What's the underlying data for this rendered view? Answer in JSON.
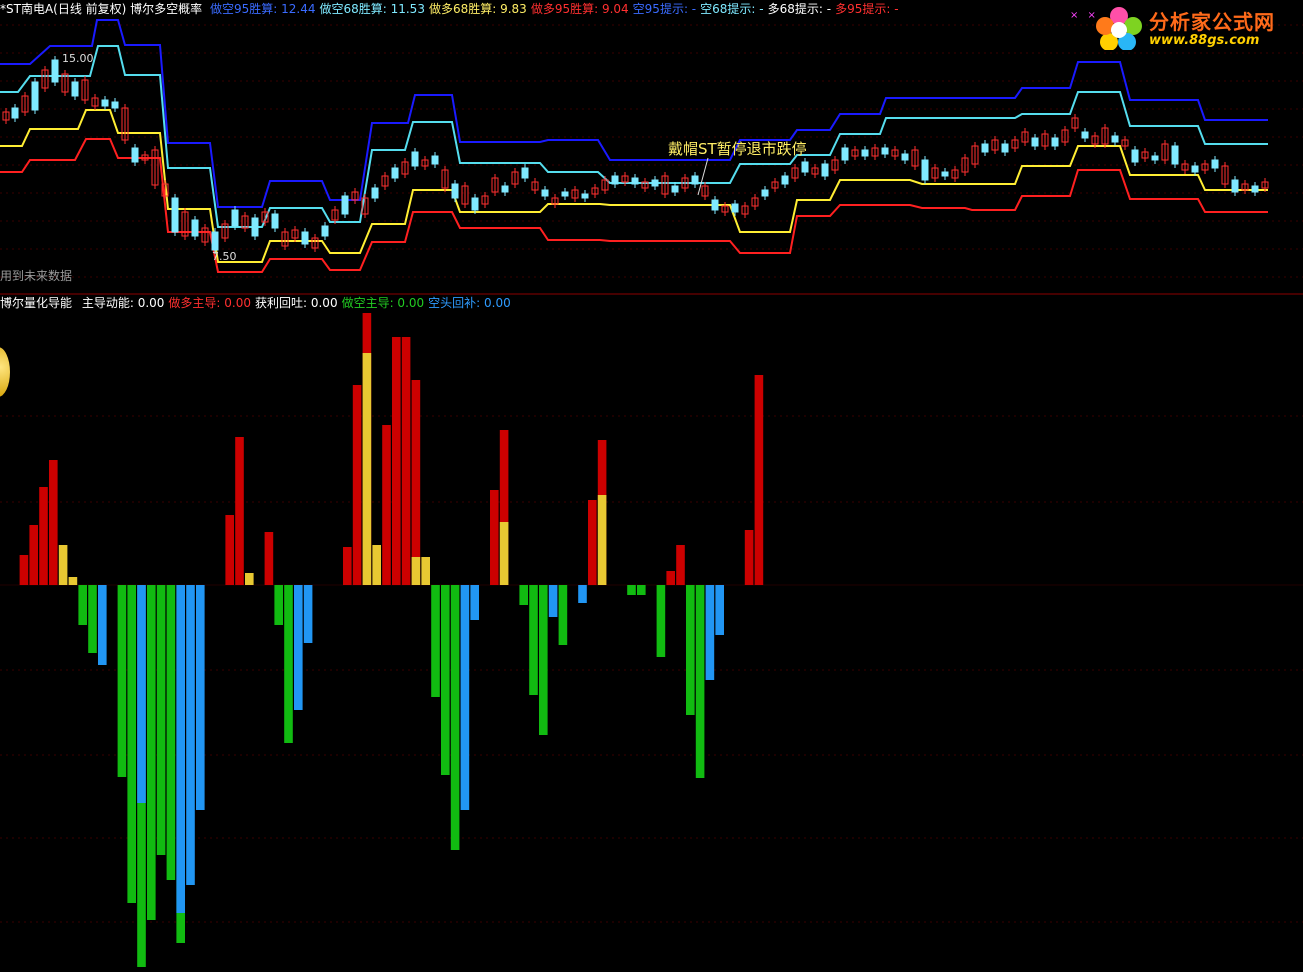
{
  "header": {
    "title": "*ST南电A(日线 前复权) 博尔多空概率",
    "items": [
      {
        "label": "做空95胜算:",
        "value": "12.44",
        "color": "#3a6bff"
      },
      {
        "label": "做空68胜算:",
        "value": "11.53",
        "color": "#7fe9ff"
      },
      {
        "label": "做多68胜算:",
        "value": "9.83",
        "color": "#ffee66"
      },
      {
        "label": "做多95胜算:",
        "value": "9.04",
        "color": "#ff3030"
      },
      {
        "label": "空95提示:",
        "value": "-",
        "color": "#3a6bff"
      },
      {
        "label": "空68提示:",
        "value": "-",
        "color": "#7fe9ff"
      },
      {
        "label": "多68提示:",
        "value": "-",
        "color": "#ffffff"
      },
      {
        "label": "多95提示:",
        "value": "-",
        "color": "#ff3030"
      }
    ]
  },
  "note": "用到未来数据",
  "annotation": "戴帽ST暂停退市跌停",
  "price_labels": {
    "high": "15.00",
    "low": "7.50"
  },
  "logo": {
    "text": "分析家公式网",
    "url": "www.88gs.com"
  },
  "indicator": {
    "title": "博尔量化导能",
    "items": [
      {
        "label": "主导动能:",
        "value": "0.00",
        "color": "#ffffff"
      },
      {
        "label": "做多主导:",
        "value": "0.00",
        "color": "#ff3030"
      },
      {
        "label": "获利回吐:",
        "value": "0.00",
        "color": "#ffffff"
      },
      {
        "label": "做空主导:",
        "value": "0.00",
        "color": "#22cc22"
      },
      {
        "label": "空头回补:",
        "value": "0.00",
        "color": "#2e9bff"
      }
    ]
  },
  "colors": {
    "up": "#ff3030",
    "down": "#7fe9ff",
    "band95_upper": "#1a1aff",
    "band68_upper": "#55ddee",
    "band68_lower": "#ffee33",
    "band95_lower": "#ff2020",
    "bull": "#cc0000",
    "profit_taking": "#e8c832",
    "bear": "#11bb11",
    "short_cover": "#2196f3"
  },
  "chart_data": {
    "type": "bar",
    "title": "博尔量化导能",
    "series": [
      {
        "name": "做多主导",
        "values": [
          0,
          0,
          30,
          60,
          98,
          125,
          0,
          0,
          0,
          0,
          0,
          0,
          0,
          0,
          0,
          0,
          0,
          0,
          0,
          0,
          0,
          0,
          0,
          70,
          148,
          0,
          0,
          53,
          0,
          0,
          0,
          0,
          0,
          0,
          0,
          38,
          200,
          272,
          0,
          160,
          248,
          248,
          205,
          0,
          0,
          0,
          0,
          0,
          0,
          0,
          95,
          155,
          0,
          0,
          0,
          0,
          0,
          0,
          0,
          0,
          85,
          145,
          0,
          0,
          0,
          0,
          0,
          0,
          14,
          40,
          0,
          0,
          0,
          0,
          0,
          0,
          55,
          210,
          0,
          0,
          0,
          0,
          0,
          0,
          0,
          0,
          0,
          0,
          0,
          0,
          0,
          0,
          0,
          0,
          0,
          0,
          0,
          0,
          0,
          0,
          0,
          0,
          0,
          0,
          0,
          0,
          0,
          0,
          0,
          0,
          0,
          0,
          0,
          0,
          0,
          0,
          0,
          0,
          0,
          0,
          0,
          0,
          0,
          0,
          0,
          0,
          0,
          0
        ]
      },
      {
        "name": "获利回吐",
        "values": [
          0,
          0,
          0,
          0,
          0,
          0,
          40,
          8,
          0,
          0,
          0,
          0,
          0,
          0,
          0,
          0,
          0,
          0,
          0,
          0,
          0,
          0,
          0,
          0,
          0,
          12,
          0,
          0,
          0,
          0,
          0,
          0,
          0,
          0,
          0,
          0,
          0,
          232,
          40,
          0,
          0,
          0,
          28,
          28,
          0,
          0,
          0,
          0,
          0,
          0,
          0,
          63,
          0,
          0,
          0,
          0,
          0,
          0,
          0,
          0,
          0,
          90,
          0,
          0,
          0,
          0,
          0,
          0,
          0,
          0,
          0,
          0,
          0,
          0,
          0,
          0,
          0,
          0,
          0,
          0,
          0,
          0,
          0,
          0,
          0,
          0,
          0,
          0,
          0,
          0,
          0,
          0,
          0,
          0,
          0,
          0,
          0,
          0,
          0,
          0,
          0,
          0,
          0,
          0,
          0,
          0,
          0,
          0,
          0,
          0,
          0,
          0,
          0,
          0,
          0,
          0,
          0,
          0,
          0,
          0,
          0,
          0,
          0,
          0,
          0,
          0,
          0,
          0,
          0,
          0
        ]
      },
      {
        "name": "做空主导",
        "values": [
          0,
          0,
          0,
          0,
          0,
          0,
          0,
          0,
          -40,
          -68,
          0,
          0,
          -192,
          -318,
          -382,
          -335,
          -270,
          -295,
          -358,
          0,
          0,
          0,
          0,
          0,
          0,
          0,
          0,
          0,
          -40,
          -158,
          0,
          0,
          0,
          0,
          0,
          0,
          0,
          0,
          0,
          0,
          0,
          0,
          0,
          0,
          -112,
          -190,
          -265,
          0,
          0,
          0,
          0,
          0,
          0,
          -20,
          -110,
          -150,
          0,
          -60,
          0,
          0,
          0,
          0,
          0,
          0,
          -10,
          -10,
          0,
          -72,
          0,
          0,
          -130,
          -193,
          0,
          0,
          0,
          0,
          0,
          0,
          0,
          0,
          0,
          0,
          0,
          0,
          0,
          0,
          0,
          0,
          0,
          0,
          0,
          0,
          0,
          0,
          0,
          0,
          0,
          0,
          0,
          0,
          0,
          0,
          0,
          0,
          0,
          0,
          0,
          0,
          0,
          0,
          0,
          0,
          0,
          0,
          0,
          0,
          0,
          0,
          0,
          0,
          0,
          0,
          0,
          0,
          0,
          0,
          0,
          0,
          0,
          0
        ]
      },
      {
        "name": "空头回补",
        "values": [
          0,
          0,
          0,
          0,
          0,
          0,
          0,
          0,
          0,
          0,
          -80,
          0,
          0,
          0,
          -218,
          0,
          0,
          0,
          -328,
          -300,
          -225,
          0,
          0,
          0,
          0,
          0,
          0,
          0,
          0,
          0,
          -125,
          -58,
          0,
          0,
          0,
          0,
          0,
          0,
          0,
          0,
          0,
          0,
          0,
          0,
          0,
          0,
          0,
          -225,
          -35,
          0,
          0,
          0,
          0,
          0,
          0,
          0,
          -32,
          0,
          0,
          -18,
          0,
          0,
          0,
          0,
          0,
          0,
          0,
          0,
          0,
          0,
          0,
          0,
          -95,
          -50,
          0,
          0,
          0,
          0,
          0,
          0,
          0,
          0,
          0,
          0,
          0,
          0,
          0,
          0,
          0,
          0,
          0,
          0,
          0,
          0,
          0,
          0,
          0,
          0,
          0,
          0,
          0,
          0,
          0,
          0,
          0,
          0,
          0,
          0,
          0,
          0,
          0,
          0,
          0,
          0,
          0,
          0,
          0,
          0,
          0,
          0,
          0,
          0,
          0,
          0,
          0,
          0
        ]
      }
    ]
  }
}
